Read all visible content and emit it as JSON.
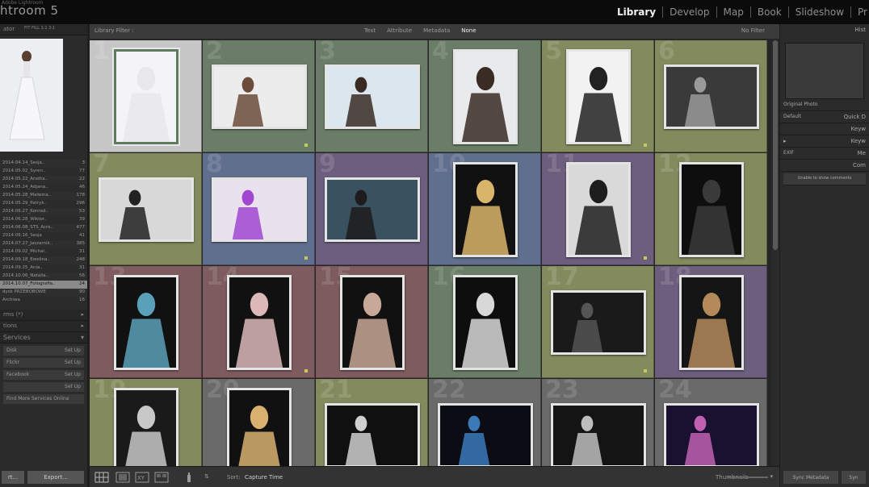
{
  "app": {
    "title": "htroom 5",
    "subtitle": "Adobe Lightroom"
  },
  "modules": [
    {
      "label": "Library",
      "active": true
    },
    {
      "label": "Develop",
      "active": false
    },
    {
      "label": "Map",
      "active": false
    },
    {
      "label": "Book",
      "active": false
    },
    {
      "label": "Slideshow",
      "active": false
    },
    {
      "label": "Pr",
      "active": false
    }
  ],
  "left": {
    "navigator_label": "ator",
    "navigator_zoom": "FIT  FILL  1:1  3:1",
    "folders": [
      {
        "name": "2014.04.14_Sesja..",
        "count": "3"
      },
      {
        "name": "2014.05.02_Syren..",
        "count": "77"
      },
      {
        "name": "2014.05.22_Anetta..",
        "count": "22"
      },
      {
        "name": "2014.05.24_Adjana..",
        "count": "46"
      },
      {
        "name": "2014.05.28_Malwina..",
        "count": "178"
      },
      {
        "name": "2014.05.29_Patryk..",
        "count": "296"
      },
      {
        "name": "2014.06.27_Konrad..",
        "count": "53"
      },
      {
        "name": "2014.06.28_Wiktor..",
        "count": "39"
      },
      {
        "name": "2014.06.08_STS_Acro..",
        "count": "477"
      },
      {
        "name": "2014.06.16_Sesja",
        "count": "41"
      },
      {
        "name": "2014.07.27_Jaszarnik..",
        "count": "385"
      },
      {
        "name": "2014.09.02_Michal..",
        "count": "31"
      },
      {
        "name": "2014.09.18_Ewelina..",
        "count": "248"
      },
      {
        "name": "2014.09.25_Ania..",
        "count": "31"
      },
      {
        "name": "2014.10.06_Natalia..",
        "count": "56"
      },
      {
        "name": "2014.10.07_Fotografia..",
        "count": "24"
      },
      {
        "name": "dysk PRZEBOBOWE",
        "count": "90"
      },
      {
        "name": "Archiwa",
        "count": "16"
      }
    ],
    "selected_folder_index": 15,
    "collections_label": "tions",
    "publish_label": "Services",
    "publish_rows": [
      {
        "name": "Disk",
        "action": "Set Up"
      },
      {
        "name": "Flickr",
        "action": "Set Up"
      },
      {
        "name": "Facebook",
        "action": "Set Up"
      },
      {
        "name": "",
        "action": "Set Up"
      },
      {
        "name": "Find More Services Online",
        "action": ""
      }
    ],
    "import_label": "rt...",
    "export_label": "Export..."
  },
  "filter": {
    "title": "Library Filter :",
    "tabs": [
      "Text",
      "Attribute",
      "Metadata",
      "None"
    ],
    "active_tab": "None",
    "right": "No Filter"
  },
  "grid": {
    "cells": [
      {
        "n": "1",
        "color": "#c6c6c6",
        "thumb": "portrait",
        "tone": "#f4f4f6",
        "subject": "#e8e8ec",
        "selected": true
      },
      {
        "n": "2",
        "color": "#6a7d66",
        "thumb": "landscape",
        "tone": "#ececec",
        "subject": "#6b4c3a"
      },
      {
        "n": "3",
        "color": "#6a7d66",
        "thumb": "landscape",
        "tone": "#dce6ee",
        "subject": "#3a2c24"
      },
      {
        "n": "4",
        "color": "#6a7d66",
        "thumb": "portrait",
        "tone": "#e8eaec",
        "subject": "#3a2c24"
      },
      {
        "n": "5",
        "color": "#838a5e",
        "thumb": "portrait",
        "tone": "#f2f2f2",
        "subject": "#222"
      },
      {
        "n": "6",
        "color": "#838a5e",
        "thumb": "landscape",
        "tone": "#3a3a3a",
        "subject": "#9a9a9a"
      },
      {
        "n": "7",
        "color": "#838a5e",
        "thumb": "landscape",
        "tone": "#d8d8d8",
        "subject": "#222"
      },
      {
        "n": "8",
        "color": "#616f8e",
        "thumb": "landscape",
        "tone": "#e9e2ee",
        "subject": "#a046d0"
      },
      {
        "n": "9",
        "color": "#6c5f7e",
        "thumb": "landscape",
        "tone": "#3a5260",
        "subject": "#1c1c1c"
      },
      {
        "n": "10",
        "color": "#616f8e",
        "thumb": "portrait",
        "tone": "#111",
        "subject": "#d9b56a"
      },
      {
        "n": "11",
        "color": "#6c5f7e",
        "thumb": "portrait",
        "tone": "#d9d9d9",
        "subject": "#1e1e1e"
      },
      {
        "n": "12",
        "color": "#838a5e",
        "thumb": "portrait",
        "tone": "#0e0e0e",
        "subject": "#3a3a3a"
      },
      {
        "n": "13",
        "color": "#7d5b5e",
        "thumb": "portrait",
        "tone": "#111",
        "subject": "#5aa0b8"
      },
      {
        "n": "14",
        "color": "#7d5b5e",
        "thumb": "portrait",
        "tone": "#111",
        "subject": "#dcb8b8"
      },
      {
        "n": "15",
        "color": "#7d5b5e",
        "thumb": "portrait",
        "tone": "#111",
        "subject": "#c8a898"
      },
      {
        "n": "16",
        "color": "#6a7d66",
        "thumb": "portrait",
        "tone": "#0e0e0e",
        "subject": "#d8d8d8"
      },
      {
        "n": "17",
        "color": "#838a5e",
        "thumb": "landscape",
        "tone": "#1a1a1a",
        "subject": "#555"
      },
      {
        "n": "18",
        "color": "#6c5f7e",
        "thumb": "portrait",
        "tone": "#151515",
        "subject": "#b48a5a"
      },
      {
        "n": "19",
        "color": "#838a5e",
        "thumb": "portrait",
        "tone": "#1a1a1a",
        "subject": "#c8c8c8"
      },
      {
        "n": "20",
        "color": "#6a6a6a",
        "thumb": "portrait",
        "tone": "#111",
        "subject": "#d8b070"
      },
      {
        "n": "21",
        "color": "#838a5e",
        "thumb": "landscape",
        "tone": "#101010",
        "subject": "#cfcfcf"
      },
      {
        "n": "22",
        "color": "#6a6a6a",
        "thumb": "landscape",
        "tone": "#0c0c14",
        "subject": "#3a7ab8"
      },
      {
        "n": "23",
        "color": "#6a6a6a",
        "thumb": "landscape",
        "tone": "#141414",
        "subject": "#bdbdbd"
      },
      {
        "n": "24",
        "color": "#6a6a6a",
        "thumb": "landscape",
        "tone": "#1a1030",
        "subject": "#c060b0"
      }
    ]
  },
  "toolbar": {
    "sort_label": "Sort:",
    "sort_value": "Capture Time",
    "thumbnails_label": "Thumbnails"
  },
  "right": {
    "histogram_label": "Hist",
    "original_photo": "Original Photo",
    "quick_develop_preset": "Default",
    "quick_develop_label": "Quick D",
    "keywording_label": "Keyw",
    "keyword_list_label": "Keyw",
    "metadata_preset": "EXIF",
    "metadata_label": "Me",
    "comments_label": "Com",
    "comments_note": "Unable to show comments",
    "sync_button": "Sync Metadata",
    "sync_settings": "Syn"
  }
}
